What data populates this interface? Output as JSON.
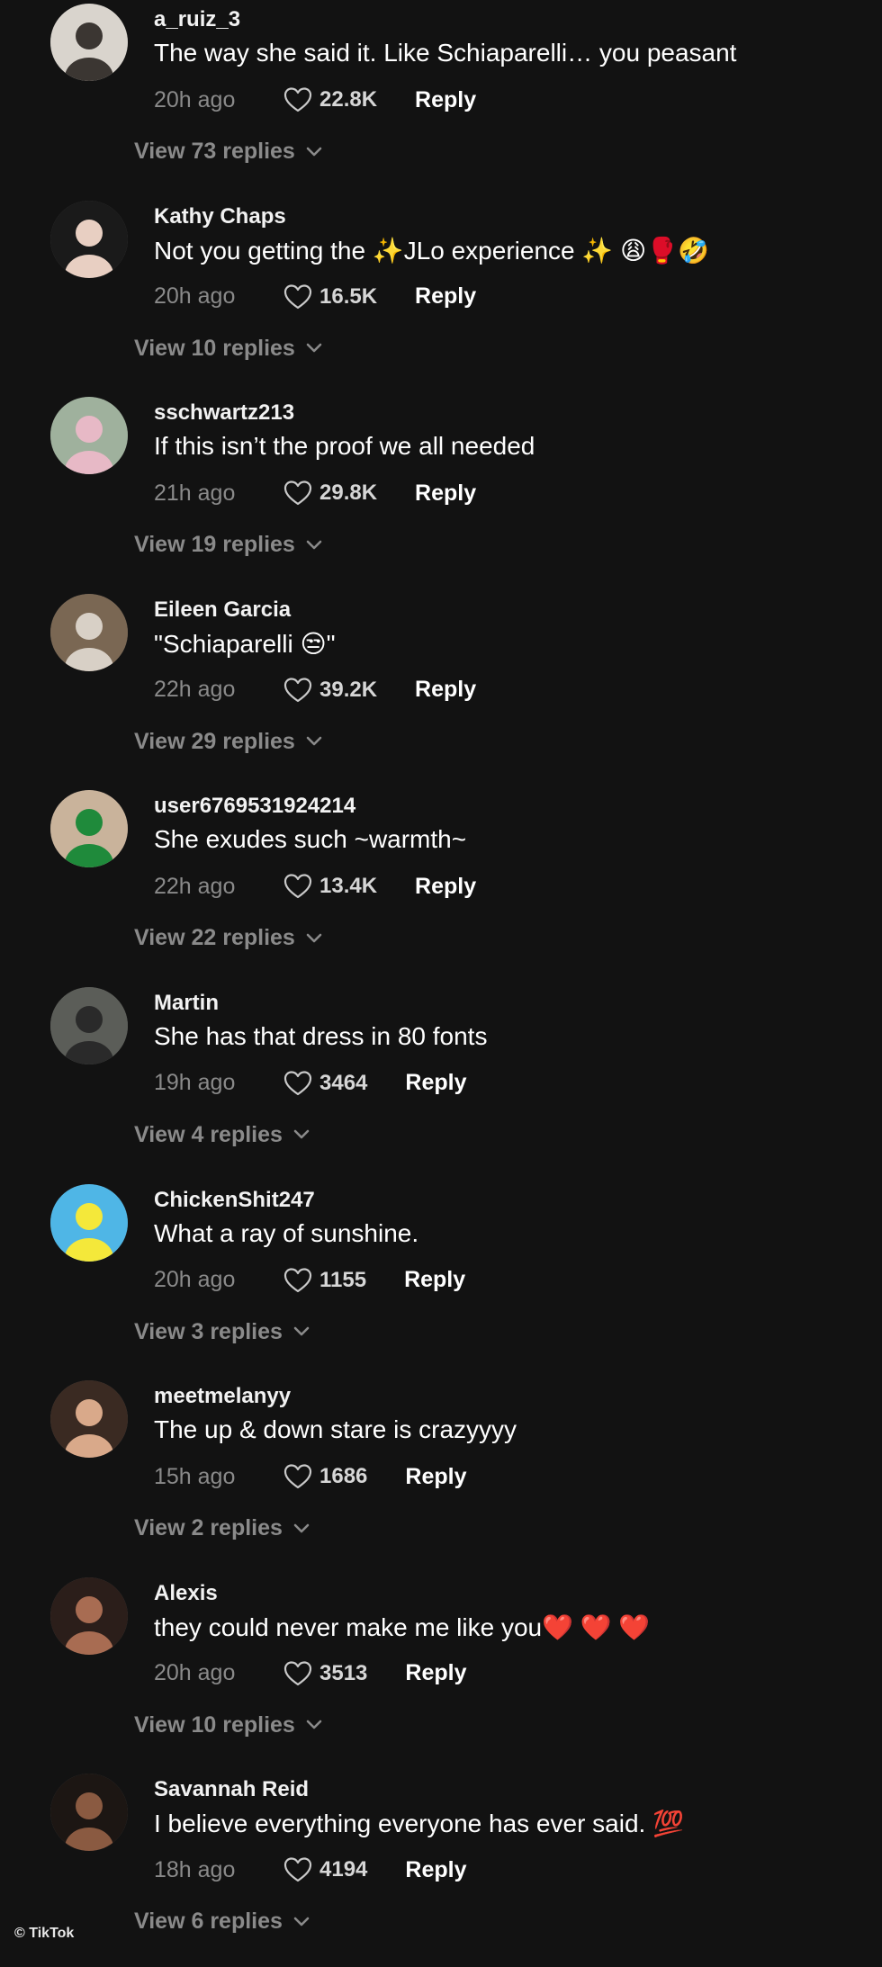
{
  "colors": {
    "background": "#121212",
    "text_primary": "#ffffff",
    "text_secondary": "#8a8a8a",
    "heart_red": "#e0242f"
  },
  "comments": [
    {
      "username": "a_ruiz_3",
      "text": "The way she said it. Like Schiaparelli… you peasant",
      "time": "20h ago",
      "likes": "22.8K",
      "reply_label": "Reply",
      "view_replies": "View 73 replies",
      "avatar_color": "#d9d4cd",
      "avatar_accent": "#3b3632"
    },
    {
      "username": "Kathy Chaps",
      "text": "Not you getting the ✨JLo experience ✨ 😩🥊🤣",
      "time": "20h ago",
      "likes": "16.5K",
      "reply_label": "Reply",
      "view_replies": "View 10 replies",
      "avatar_color": "#1a1a1a",
      "avatar_accent": "#e8cfc2"
    },
    {
      "username": "sschwartz213",
      "text": "If this isn’t the proof we all needed",
      "time": "21h ago",
      "likes": "29.8K",
      "reply_label": "Reply",
      "view_replies": "View 19 replies",
      "avatar_color": "#9fb19d",
      "avatar_accent": "#e7b9c6"
    },
    {
      "username": "Eileen Garcia",
      "text": "\"Schiaparelli 😒\"",
      "time": "22h ago",
      "likes": "39.2K",
      "reply_label": "Reply",
      "view_replies": "View 29 replies",
      "avatar_color": "#7a6753",
      "avatar_accent": "#d8d0c6"
    },
    {
      "username": "user6769531924214",
      "text": "She exudes such ~warmth~",
      "time": "22h ago",
      "likes": "13.4K",
      "reply_label": "Reply",
      "view_replies": "View 22 replies",
      "avatar_color": "#c9b39b",
      "avatar_accent": "#1f8a3b"
    },
    {
      "username": "Martin",
      "text": "She has that dress in 80 fonts",
      "time": "19h ago",
      "likes": "3464",
      "reply_label": "Reply",
      "view_replies": "View 4 replies",
      "avatar_color": "#5b5d58",
      "avatar_accent": "#2a2a2a"
    },
    {
      "username": "ChickenShit247",
      "text": "What a ray of sunshine.",
      "time": "20h ago",
      "likes": "1155",
      "reply_label": "Reply",
      "view_replies": "View 3 replies",
      "avatar_color": "#4fb6e6",
      "avatar_accent": "#f4e83a"
    },
    {
      "username": "meetmelanyy",
      "text": "The up & down stare is crazyyyy",
      "time": "15h ago",
      "likes": "1686",
      "reply_label": "Reply",
      "view_replies": "View 2 replies",
      "avatar_color": "#3a2a22",
      "avatar_accent": "#d9a98a"
    },
    {
      "username": "Alexis",
      "text": "they could never make me like you❤️ ❤️ ❤️",
      "time": "20h ago",
      "likes": "3513",
      "reply_label": "Reply",
      "view_replies": "View 10 replies",
      "avatar_color": "#2b1e1a",
      "avatar_accent": "#a86c52"
    },
    {
      "username": "Savannah Reid",
      "text": "I believe everything everyone has ever said. 💯",
      "time": "18h ago",
      "likes": "4194",
      "reply_label": "Reply",
      "view_replies": "View 6 replies",
      "avatar_color": "#1c1613",
      "avatar_accent": "#8a5a41"
    }
  ],
  "watermark": "© TikTok"
}
